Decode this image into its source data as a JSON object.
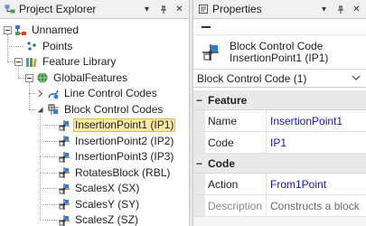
{
  "explorer": {
    "title": "Project Explorer",
    "pin_glyph": "⊥",
    "close_glyph": "✕",
    "menu_glyph": "▾",
    "tree": [
      {
        "label": "Unnamed",
        "depth": 0,
        "expander": "minus",
        "icon": "root-icon"
      },
      {
        "label": "Points",
        "depth": 1,
        "expander": "none",
        "icon": "points-icon"
      },
      {
        "label": "Feature Library",
        "depth": 1,
        "expander": "minus",
        "icon": "library-icon"
      },
      {
        "label": "GlobalFeatures",
        "depth": 2,
        "expander": "minus",
        "icon": "globe-icon"
      },
      {
        "label": "Line Control Codes",
        "depth": 3,
        "expander": "collapsed",
        "icon": "line-codes-icon"
      },
      {
        "label": "Block Control Codes",
        "depth": 3,
        "expander": "expanded",
        "icon": "block-codes-icon"
      },
      {
        "label": "InsertionPoint1 (IP1)",
        "depth": 4,
        "expander": "none",
        "icon": "control-code-icon",
        "selected": true
      },
      {
        "label": "InsertionPoint2 (IP2)",
        "depth": 4,
        "expander": "none",
        "icon": "control-code-icon"
      },
      {
        "label": "InsertionPoint3 (IP3)",
        "depth": 4,
        "expander": "none",
        "icon": "control-code-icon"
      },
      {
        "label": "RotatesBlock (RBL)",
        "depth": 4,
        "expander": "none",
        "icon": "control-code-icon"
      },
      {
        "label": "ScalesX (SX)",
        "depth": 4,
        "expander": "none",
        "icon": "control-code-icon"
      },
      {
        "label": "ScalesY (SY)",
        "depth": 4,
        "expander": "none",
        "icon": "control-code-icon"
      },
      {
        "label": "ScalesZ (SZ)",
        "depth": 4,
        "expander": "none",
        "icon": "control-code-icon"
      }
    ]
  },
  "properties": {
    "title": "Properties",
    "pin_glyph": "⊥",
    "close_glyph": "✕",
    "menu_glyph": "▾",
    "object_type": "Block Control Code",
    "object_name": "InsertionPoint1 (IP1)",
    "selector_value": "Block Control Code (1)",
    "categories": [
      {
        "name": "Feature",
        "toggle": "−",
        "rows": [
          {
            "name": "Name",
            "value": "InsertionPoint1"
          },
          {
            "name": "Code",
            "value": "IP1"
          }
        ]
      },
      {
        "name": "Code",
        "toggle": "−",
        "rows": [
          {
            "name": "Action",
            "value": "From1Point"
          },
          {
            "name": "Description",
            "value": "Constructs a block",
            "muted": true
          }
        ]
      }
    ]
  },
  "colors": {
    "selection_fill": "#ffe9a6",
    "selection_border": "#e5b94a",
    "value_text": "#1414b4"
  }
}
